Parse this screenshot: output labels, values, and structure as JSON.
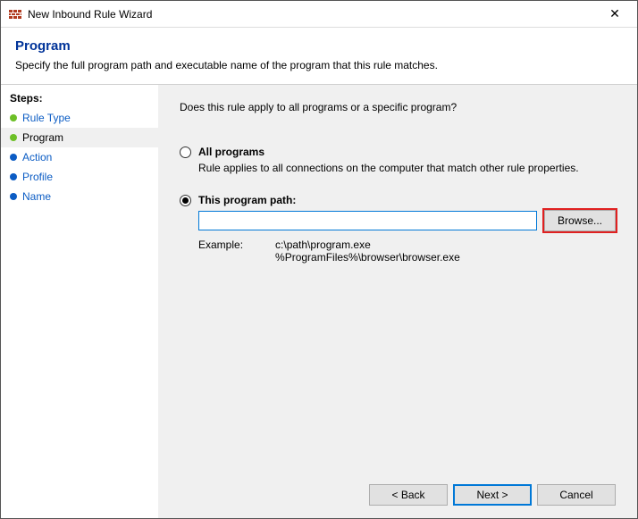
{
  "window": {
    "title": "New Inbound Rule Wizard"
  },
  "header": {
    "title": "Program",
    "subtitle": "Specify the full program path and executable name of the program that this rule matches."
  },
  "sidebar": {
    "label": "Steps:",
    "items": [
      {
        "label": "Rule Type",
        "state": "done"
      },
      {
        "label": "Program",
        "state": "current"
      },
      {
        "label": "Action",
        "state": "todo"
      },
      {
        "label": "Profile",
        "state": "todo"
      },
      {
        "label": "Name",
        "state": "todo"
      }
    ]
  },
  "main": {
    "question": "Does this rule apply to all programs or a specific program?",
    "options": {
      "all": {
        "label": "All programs",
        "desc": "Rule applies to all connections on the computer that match other rule properties."
      },
      "path": {
        "label": "This program path:",
        "value": "",
        "browse_label": "Browse...",
        "example_label": "Example:",
        "example_text": "c:\\path\\program.exe\n%ProgramFiles%\\browser\\browser.exe"
      }
    }
  },
  "buttons": {
    "back": "< Back",
    "next": "Next >",
    "cancel": "Cancel"
  }
}
